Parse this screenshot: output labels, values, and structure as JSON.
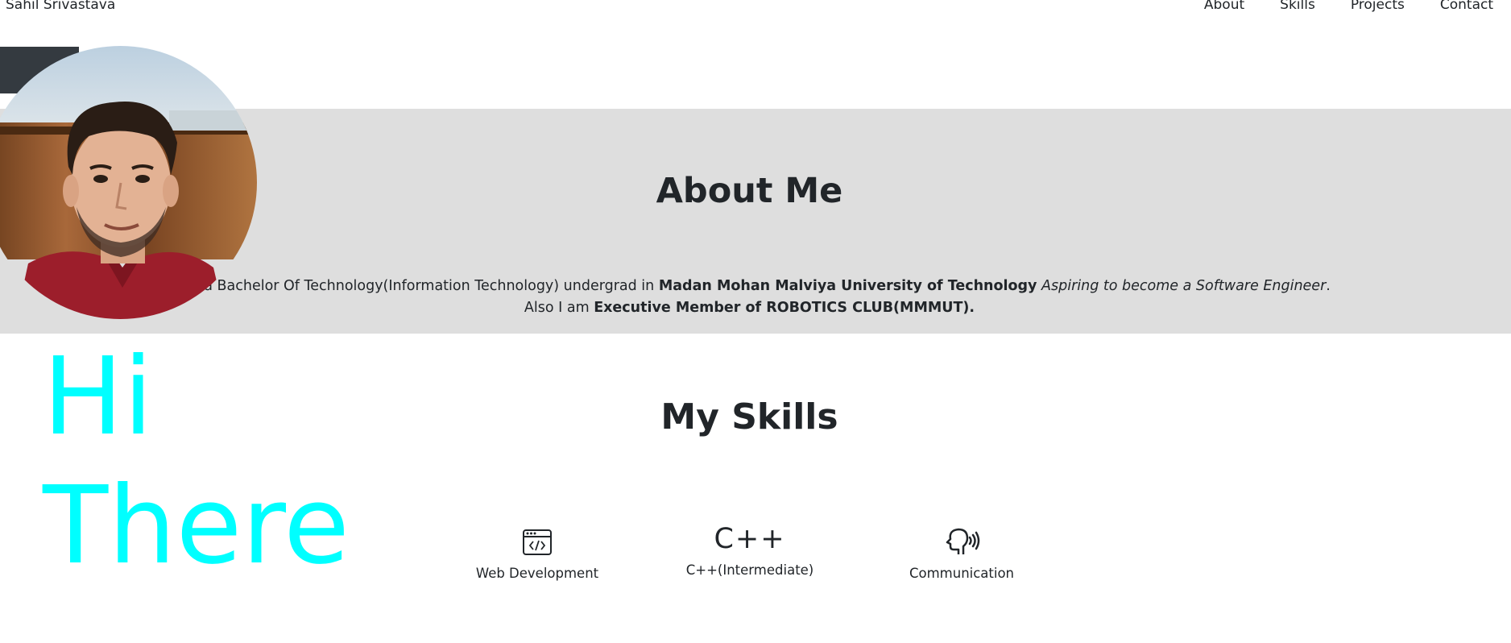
{
  "nav": {
    "brand": "Sahil Srivastava",
    "links": [
      {
        "label": "About"
      },
      {
        "label": "Skills"
      },
      {
        "label": "Projects"
      },
      {
        "label": "Contact"
      }
    ]
  },
  "hero": {
    "greeting_line1": "Hi",
    "greeting_line2": "There",
    "greeting_color": "#00ffff"
  },
  "about": {
    "title": "About Me",
    "text_1": "I am a Bachelor Of Technology(Information Technology) undergrad in ",
    "university": "Madan Mohan Malviya University of Technology",
    "aspiration": "Aspiring to become a Software Engineer",
    "period": ".",
    "text_2": "Also I am ",
    "role": "Executive Member of ROBOTICS CLUB(MMMUT).",
    "background": "#dedede"
  },
  "skills": {
    "title": "My Skills",
    "items": [
      {
        "label": "Web Development",
        "icon": "code-window-icon"
      },
      {
        "label": "C++(Intermediate)",
        "icon": "cpp-icon",
        "glyph": "C++"
      },
      {
        "label": "Communication",
        "icon": "speaking-head-icon"
      }
    ]
  }
}
